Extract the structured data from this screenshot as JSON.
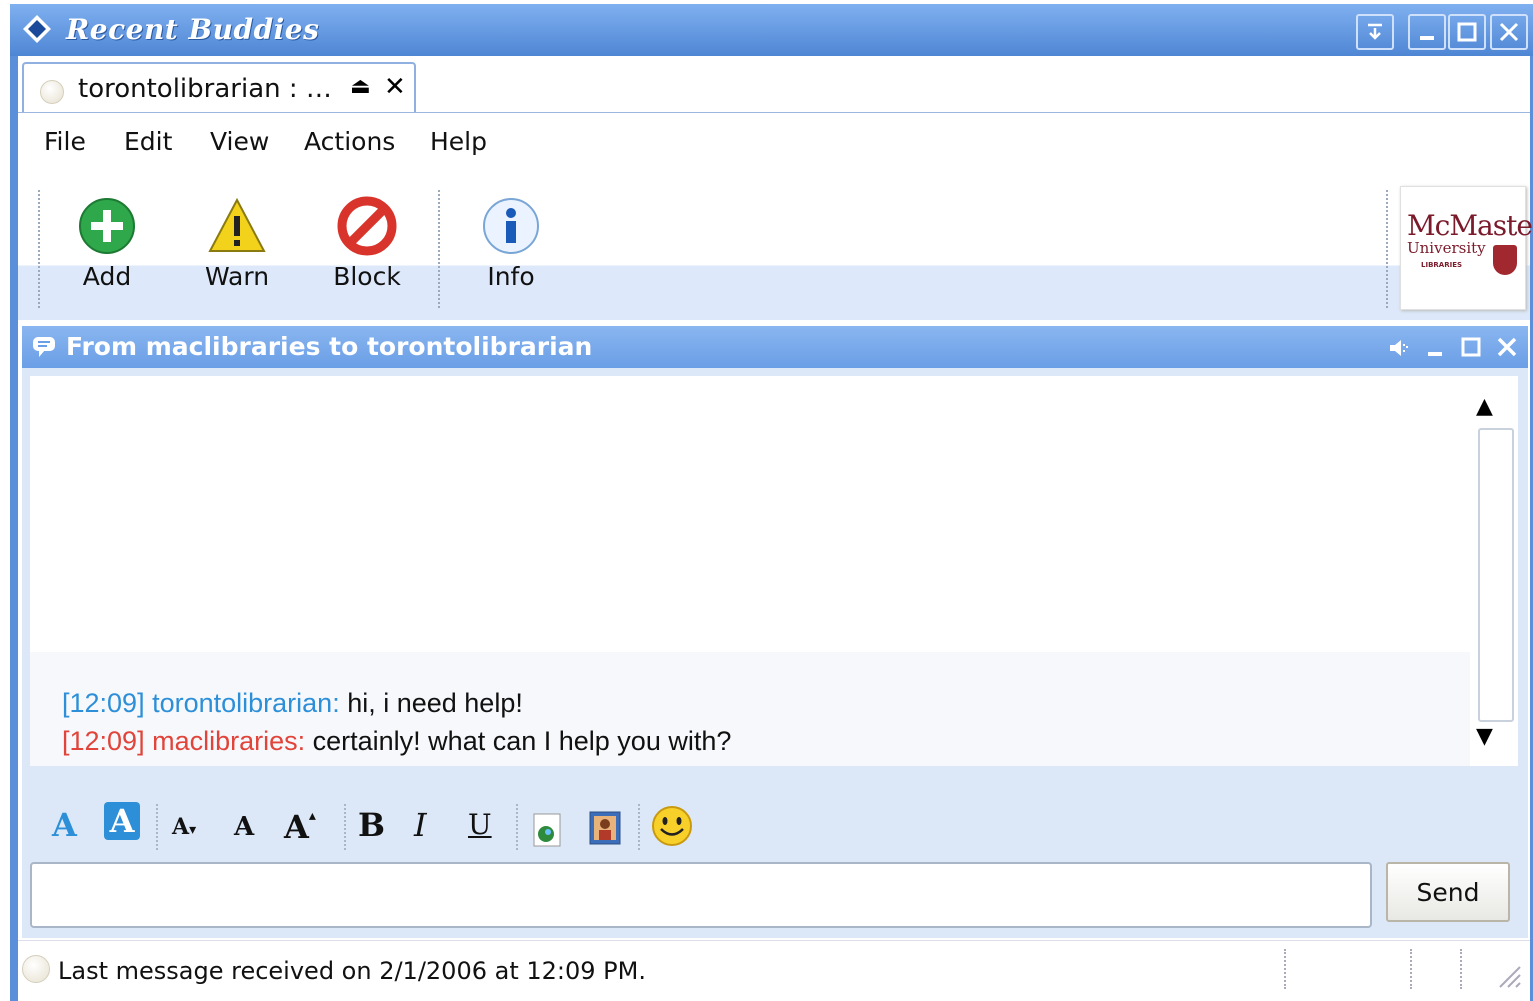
{
  "window": {
    "title": "Recent Buddies",
    "controls": [
      "menu-button",
      "minimize-button",
      "maximize-button",
      "close-button"
    ]
  },
  "tab": {
    "label": "torontolibrarian : …",
    "eject_glyph": "⏏",
    "close_glyph": "✕"
  },
  "menu": {
    "items": [
      "File",
      "Edit",
      "View",
      "Actions",
      "Help"
    ]
  },
  "toolbar": {
    "add": "Add",
    "warn": "Warn",
    "block": "Block",
    "info": "Info"
  },
  "logo": {
    "line1": "McMaster",
    "line2": "University",
    "line3": "LIBRARIES"
  },
  "conversation": {
    "title": "From maclibraries to torontolibrarian",
    "messages": [
      {
        "time": "[12:09]",
        "sender": "torontolibrarian:",
        "text": " hi, i need help!",
        "color": "#2d8fd8"
      },
      {
        "time": "[12:09]",
        "sender": "maclibraries:",
        "text": " certainly!  what can I help you with?",
        "color": "#e0443a"
      }
    ]
  },
  "format": {
    "text_color": "A",
    "bg_color": "A",
    "smaller": "A",
    "normal": "A",
    "larger": "A",
    "bold": "B",
    "italic": "I",
    "underline": "U"
  },
  "compose": {
    "value": "",
    "send_label": "Send"
  },
  "status": {
    "text": "Last message received on 2/1/2006 at 12:09 PM."
  },
  "colors": {
    "accent": "#5b8fd9",
    "panel": "#dce8f8"
  }
}
